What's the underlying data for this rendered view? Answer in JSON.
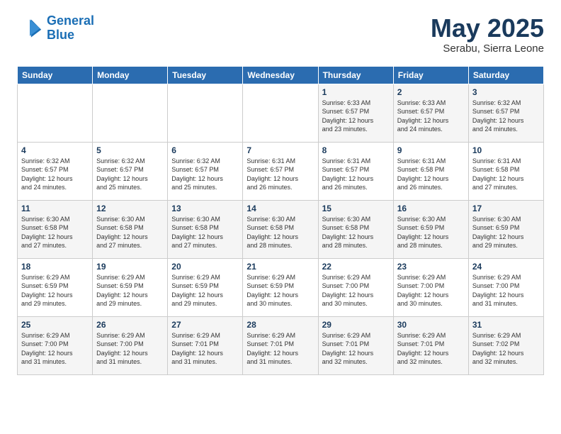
{
  "logo": {
    "line1": "General",
    "line2": "Blue"
  },
  "title": "May 2025",
  "location": "Serabu, Sierra Leone",
  "days_of_week": [
    "Sunday",
    "Monday",
    "Tuesday",
    "Wednesday",
    "Thursday",
    "Friday",
    "Saturday"
  ],
  "weeks": [
    [
      {
        "day": "",
        "info": ""
      },
      {
        "day": "",
        "info": ""
      },
      {
        "day": "",
        "info": ""
      },
      {
        "day": "",
        "info": ""
      },
      {
        "day": "1",
        "info": "Sunrise: 6:33 AM\nSunset: 6:57 PM\nDaylight: 12 hours\nand 23 minutes."
      },
      {
        "day": "2",
        "info": "Sunrise: 6:33 AM\nSunset: 6:57 PM\nDaylight: 12 hours\nand 24 minutes."
      },
      {
        "day": "3",
        "info": "Sunrise: 6:32 AM\nSunset: 6:57 PM\nDaylight: 12 hours\nand 24 minutes."
      }
    ],
    [
      {
        "day": "4",
        "info": "Sunrise: 6:32 AM\nSunset: 6:57 PM\nDaylight: 12 hours\nand 24 minutes."
      },
      {
        "day": "5",
        "info": "Sunrise: 6:32 AM\nSunset: 6:57 PM\nDaylight: 12 hours\nand 25 minutes."
      },
      {
        "day": "6",
        "info": "Sunrise: 6:32 AM\nSunset: 6:57 PM\nDaylight: 12 hours\nand 25 minutes."
      },
      {
        "day": "7",
        "info": "Sunrise: 6:31 AM\nSunset: 6:57 PM\nDaylight: 12 hours\nand 26 minutes."
      },
      {
        "day": "8",
        "info": "Sunrise: 6:31 AM\nSunset: 6:57 PM\nDaylight: 12 hours\nand 26 minutes."
      },
      {
        "day": "9",
        "info": "Sunrise: 6:31 AM\nSunset: 6:58 PM\nDaylight: 12 hours\nand 26 minutes."
      },
      {
        "day": "10",
        "info": "Sunrise: 6:31 AM\nSunset: 6:58 PM\nDaylight: 12 hours\nand 27 minutes."
      }
    ],
    [
      {
        "day": "11",
        "info": "Sunrise: 6:30 AM\nSunset: 6:58 PM\nDaylight: 12 hours\nand 27 minutes."
      },
      {
        "day": "12",
        "info": "Sunrise: 6:30 AM\nSunset: 6:58 PM\nDaylight: 12 hours\nand 27 minutes."
      },
      {
        "day": "13",
        "info": "Sunrise: 6:30 AM\nSunset: 6:58 PM\nDaylight: 12 hours\nand 27 minutes."
      },
      {
        "day": "14",
        "info": "Sunrise: 6:30 AM\nSunset: 6:58 PM\nDaylight: 12 hours\nand 28 minutes."
      },
      {
        "day": "15",
        "info": "Sunrise: 6:30 AM\nSunset: 6:58 PM\nDaylight: 12 hours\nand 28 minutes."
      },
      {
        "day": "16",
        "info": "Sunrise: 6:30 AM\nSunset: 6:59 PM\nDaylight: 12 hours\nand 28 minutes."
      },
      {
        "day": "17",
        "info": "Sunrise: 6:30 AM\nSunset: 6:59 PM\nDaylight: 12 hours\nand 29 minutes."
      }
    ],
    [
      {
        "day": "18",
        "info": "Sunrise: 6:29 AM\nSunset: 6:59 PM\nDaylight: 12 hours\nand 29 minutes."
      },
      {
        "day": "19",
        "info": "Sunrise: 6:29 AM\nSunset: 6:59 PM\nDaylight: 12 hours\nand 29 minutes."
      },
      {
        "day": "20",
        "info": "Sunrise: 6:29 AM\nSunset: 6:59 PM\nDaylight: 12 hours\nand 29 minutes."
      },
      {
        "day": "21",
        "info": "Sunrise: 6:29 AM\nSunset: 6:59 PM\nDaylight: 12 hours\nand 30 minutes."
      },
      {
        "day": "22",
        "info": "Sunrise: 6:29 AM\nSunset: 7:00 PM\nDaylight: 12 hours\nand 30 minutes."
      },
      {
        "day": "23",
        "info": "Sunrise: 6:29 AM\nSunset: 7:00 PM\nDaylight: 12 hours\nand 30 minutes."
      },
      {
        "day": "24",
        "info": "Sunrise: 6:29 AM\nSunset: 7:00 PM\nDaylight: 12 hours\nand 31 minutes."
      }
    ],
    [
      {
        "day": "25",
        "info": "Sunrise: 6:29 AM\nSunset: 7:00 PM\nDaylight: 12 hours\nand 31 minutes."
      },
      {
        "day": "26",
        "info": "Sunrise: 6:29 AM\nSunset: 7:00 PM\nDaylight: 12 hours\nand 31 minutes."
      },
      {
        "day": "27",
        "info": "Sunrise: 6:29 AM\nSunset: 7:01 PM\nDaylight: 12 hours\nand 31 minutes."
      },
      {
        "day": "28",
        "info": "Sunrise: 6:29 AM\nSunset: 7:01 PM\nDaylight: 12 hours\nand 31 minutes."
      },
      {
        "day": "29",
        "info": "Sunrise: 6:29 AM\nSunset: 7:01 PM\nDaylight: 12 hours\nand 32 minutes."
      },
      {
        "day": "30",
        "info": "Sunrise: 6:29 AM\nSunset: 7:01 PM\nDaylight: 12 hours\nand 32 minutes."
      },
      {
        "day": "31",
        "info": "Sunrise: 6:29 AM\nSunset: 7:02 PM\nDaylight: 12 hours\nand 32 minutes."
      }
    ]
  ]
}
